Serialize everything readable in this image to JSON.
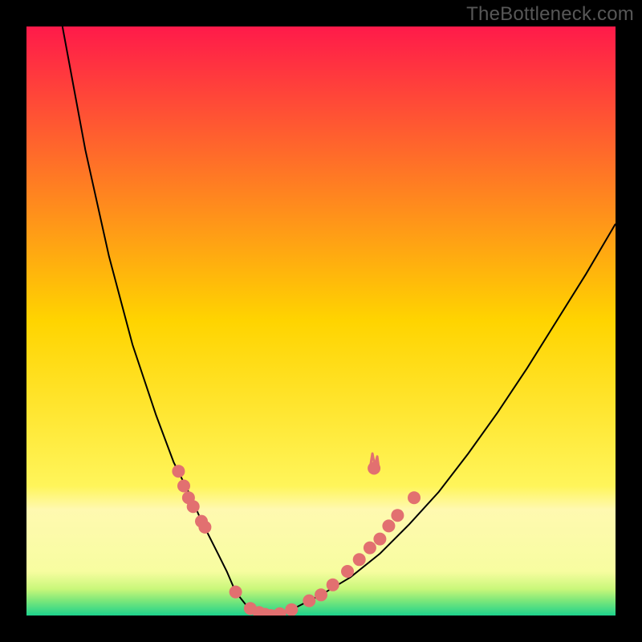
{
  "watermark": "TheBottleneck.com",
  "chart_data": {
    "type": "line",
    "title": "",
    "xlabel": "",
    "ylabel": "",
    "xlim": [
      0,
      1
    ],
    "ylim": [
      0,
      1
    ],
    "background": {
      "type": "vertical-gradient",
      "stops": [
        {
          "offset": 0.0,
          "color": "#ff1a4a"
        },
        {
          "offset": 0.5,
          "color": "#ffd400"
        },
        {
          "offset": 0.78,
          "color": "#fff55a"
        },
        {
          "offset": 0.82,
          "color": "#fff9b0"
        },
        {
          "offset": 0.925,
          "color": "#f7fda0"
        },
        {
          "offset": 0.955,
          "color": "#c9f77a"
        },
        {
          "offset": 0.975,
          "color": "#7be77a"
        },
        {
          "offset": 1.0,
          "color": "#1ed28c"
        }
      ]
    },
    "series": [
      {
        "name": "bottleneck-curve",
        "color": "#000000",
        "width": 2,
        "x_norm": [
          0.061,
          0.1,
          0.14,
          0.18,
          0.22,
          0.25,
          0.28,
          0.295,
          0.31,
          0.325,
          0.34,
          0.355,
          0.375,
          0.395,
          0.415,
          0.435,
          0.46,
          0.5,
          0.55,
          0.6,
          0.65,
          0.7,
          0.75,
          0.8,
          0.85,
          0.9,
          0.95,
          1.0
        ],
        "y_norm": [
          0.0,
          0.21,
          0.39,
          0.54,
          0.66,
          0.74,
          0.8,
          0.835,
          0.865,
          0.895,
          0.925,
          0.96,
          0.985,
          0.995,
          1.0,
          0.995,
          0.985,
          0.965,
          0.935,
          0.895,
          0.845,
          0.79,
          0.725,
          0.655,
          0.58,
          0.5,
          0.42,
          0.335
        ]
      }
    ],
    "scatter": [
      {
        "name": "dots",
        "color": "#e27070",
        "radius": 8,
        "points_norm": [
          [
            0.258,
            0.755
          ],
          [
            0.267,
            0.78
          ],
          [
            0.275,
            0.8
          ],
          [
            0.283,
            0.815
          ],
          [
            0.297,
            0.84
          ],
          [
            0.303,
            0.85
          ],
          [
            0.355,
            0.96
          ],
          [
            0.38,
            0.988
          ],
          [
            0.395,
            0.995
          ],
          [
            0.405,
            0.998
          ],
          [
            0.415,
            1.0
          ],
          [
            0.43,
            0.997
          ],
          [
            0.45,
            0.99
          ],
          [
            0.48,
            0.975
          ],
          [
            0.5,
            0.965
          ],
          [
            0.52,
            0.948
          ],
          [
            0.545,
            0.925
          ],
          [
            0.565,
            0.905
          ],
          [
            0.583,
            0.885
          ],
          [
            0.6,
            0.87
          ],
          [
            0.615,
            0.848
          ],
          [
            0.63,
            0.83
          ],
          [
            0.658,
            0.8
          ],
          [
            0.59,
            0.75
          ]
        ]
      },
      {
        "name": "outlier-spike",
        "type": "spike",
        "color": "#e27070",
        "at_norm": [
          0.59,
          0.75
        ],
        "height_norm": 0.025
      }
    ]
  }
}
